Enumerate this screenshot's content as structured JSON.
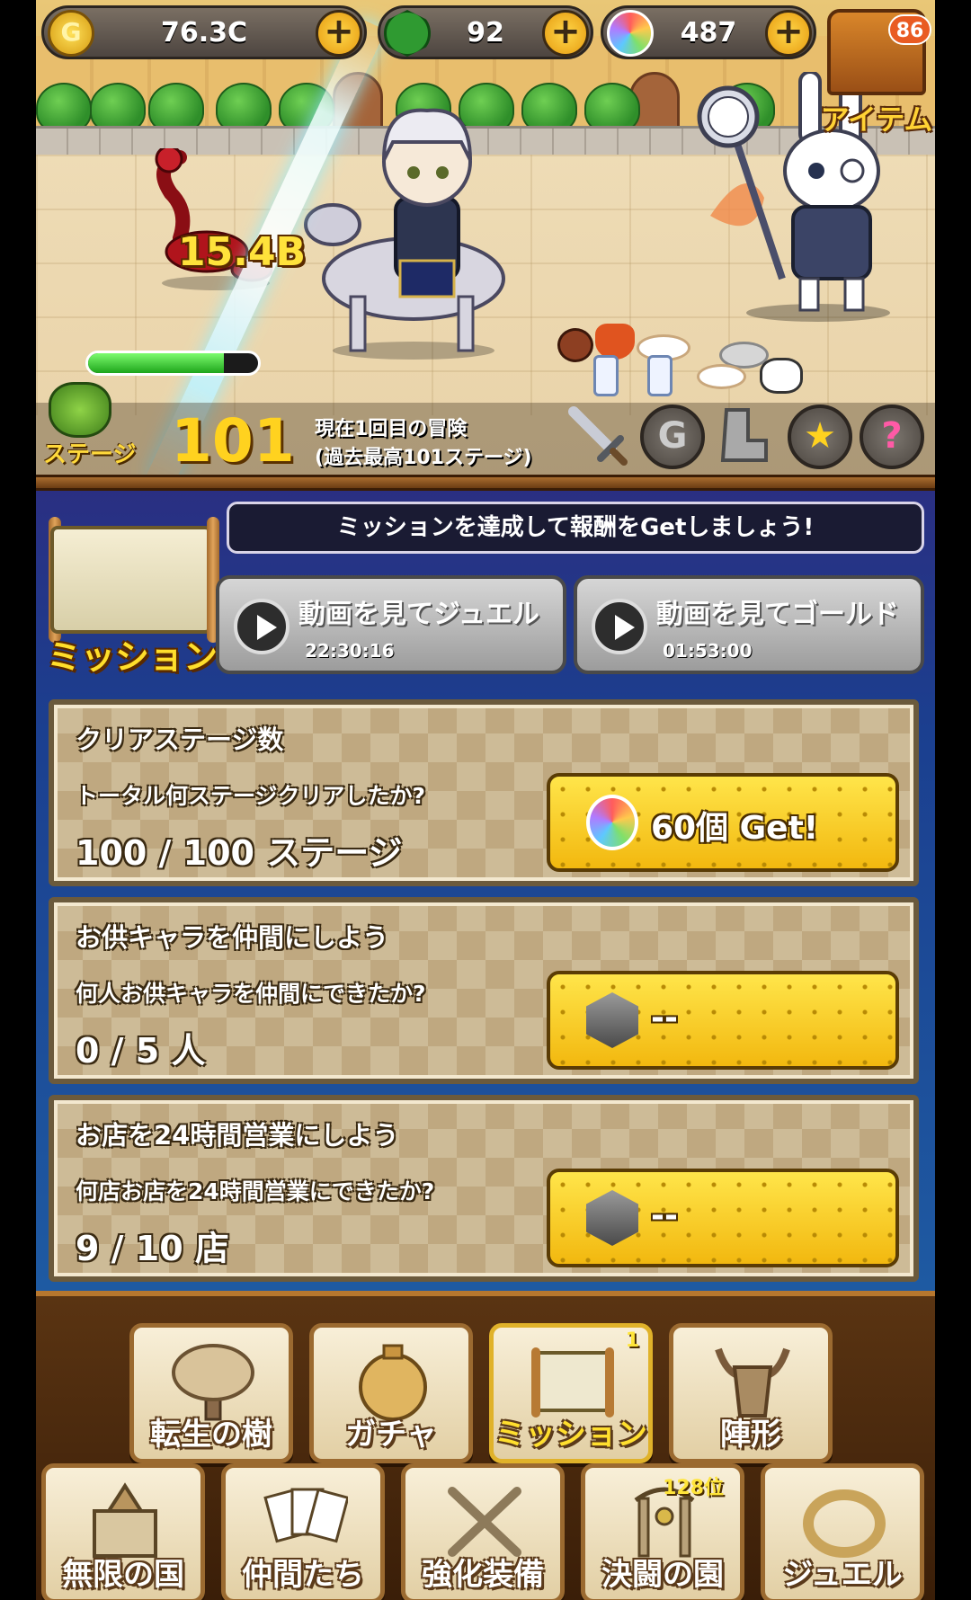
{
  "currency": {
    "gold": "76.3C",
    "jewel": "92",
    "rainbow": "487"
  },
  "item_menu": {
    "count": "86",
    "label": "アイテム"
  },
  "battle": {
    "damage": "15.4B",
    "enemy_hp_percent": 80
  },
  "stage": {
    "label": "ステージ",
    "number": "101",
    "info_line1": "現在1回目の冒険",
    "info_line2": "(過去最高101ステージ)"
  },
  "mission": {
    "title": "ミッション",
    "banner": "ミッションを達成して報酬をGetしましょう!",
    "ads": [
      {
        "label": "動画を見てジュエル",
        "timer": "22:30:16"
      },
      {
        "label": "動画を見てゴールド",
        "timer": "01:53:00"
      }
    ],
    "cards": [
      {
        "title": "クリアステージ数",
        "question": "トータル何ステージクリアしたか?",
        "progress": "100 / 100 ステージ",
        "reward": "60個 Get!",
        "reward_icon": "rainbow-gem-icon"
      },
      {
        "title": "お供キャラを仲間にしよう",
        "question": "何人お供キャラを仲間にできたか?",
        "progress": "0 / 5 人",
        "reward": "--",
        "reward_icon": "silver-gem-icon"
      },
      {
        "title": "お店を24時間営業にしよう",
        "question": "何店お店を24時間営業にできたか?",
        "progress": "9 / 10 店",
        "reward": "--",
        "reward_icon": "silver-gem-icon"
      }
    ]
  },
  "menu": {
    "row1": [
      {
        "label": "転生の樹",
        "icon": "tree-icon"
      },
      {
        "label": "ガチャ",
        "icon": "gacha-orb-icon"
      },
      {
        "label": "ミッション",
        "icon": "scroll-icon",
        "badge": "1"
      },
      {
        "label": "陣形",
        "icon": "helmet-icon"
      }
    ],
    "row2": [
      {
        "label": "無限の国",
        "icon": "castle-icon"
      },
      {
        "label": "仲間たち",
        "icon": "cards-icon"
      },
      {
        "label": "強化装備",
        "icon": "crossed-swords-icon"
      },
      {
        "label": "決闘の園",
        "icon": "arena-icon",
        "badge": "128位"
      },
      {
        "label": "ジュエル",
        "icon": "jewel-ring-icon"
      }
    ]
  },
  "colors": {
    "gold_text": "#ffde2b",
    "panel_blue": "#1b3f8f",
    "reward_gold": "#f2b80f"
  }
}
